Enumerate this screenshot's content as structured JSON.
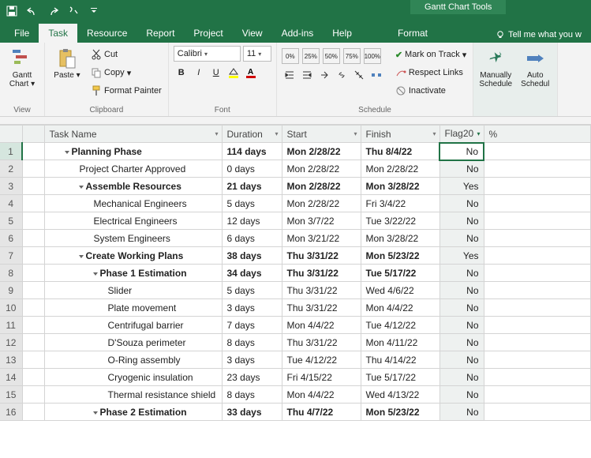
{
  "contextual_tab": "Gantt Chart Tools",
  "tabs": {
    "file": "File",
    "task": "Task",
    "resource": "Resource",
    "report": "Report",
    "project": "Project",
    "view": "View",
    "addins": "Add-ins",
    "help": "Help",
    "format": "Format"
  },
  "tellme": "Tell me what you w",
  "ribbon": {
    "view_group": "View",
    "gantt_chart": "Gantt Chart",
    "clipboard_group": "Clipboard",
    "paste": "Paste",
    "cut": "Cut",
    "copy": "Copy",
    "format_painter": "Format Painter",
    "font_group": "Font",
    "font_name": "Calibri",
    "font_size": "11",
    "schedule_group": "Schedule",
    "mark_on_track": "Mark on Track",
    "respect_links": "Respect Links",
    "inactivate": "Inactivate",
    "manually_schedule": "Manually Schedule",
    "auto_schedule": "Auto Schedul",
    "pct": {
      "p0": "0%",
      "p25": "25%",
      "p50": "50%",
      "p75": "75%",
      "p100": "100%"
    }
  },
  "columns": {
    "task_name": "Task Name",
    "duration": "Duration",
    "start": "Start",
    "finish": "Finish",
    "flag20": "Flag20",
    "pct": "%"
  },
  "rows": [
    {
      "n": 1,
      "lvl": 0,
      "sum": true,
      "name": "Planning Phase",
      "dur": "114 days",
      "start": "Mon 2/28/22",
      "finish": "Thu 8/4/22",
      "flag": "No"
    },
    {
      "n": 2,
      "lvl": 1,
      "sum": false,
      "name": "Project Charter Approved",
      "dur": "0 days",
      "start": "Mon 2/28/22",
      "finish": "Mon 2/28/22",
      "flag": "No"
    },
    {
      "n": 3,
      "lvl": 1,
      "sum": true,
      "name": "Assemble Resources",
      "dur": "21 days",
      "start": "Mon 2/28/22",
      "finish": "Mon 3/28/22",
      "flag": "Yes"
    },
    {
      "n": 4,
      "lvl": 2,
      "sum": false,
      "name": "Mechanical Engineers",
      "dur": "5 days",
      "start": "Mon 2/28/22",
      "finish": "Fri 3/4/22",
      "flag": "No"
    },
    {
      "n": 5,
      "lvl": 2,
      "sum": false,
      "name": "Electrical Engineers",
      "dur": "12 days",
      "start": "Mon 3/7/22",
      "finish": "Tue 3/22/22",
      "flag": "No"
    },
    {
      "n": 6,
      "lvl": 2,
      "sum": false,
      "name": "System Engineers",
      "dur": "6 days",
      "start": "Mon 3/21/22",
      "finish": "Mon 3/28/22",
      "flag": "No"
    },
    {
      "n": 7,
      "lvl": 1,
      "sum": true,
      "name": "Create Working Plans",
      "dur": "38 days",
      "start": "Thu 3/31/22",
      "finish": "Mon 5/23/22",
      "flag": "Yes"
    },
    {
      "n": 8,
      "lvl": 2,
      "sum": true,
      "name": "Phase 1 Estimation",
      "dur": "34 days",
      "start": "Thu 3/31/22",
      "finish": "Tue 5/17/22",
      "flag": "No"
    },
    {
      "n": 9,
      "lvl": 3,
      "sum": false,
      "name": "Slider",
      "dur": "5 days",
      "start": "Thu 3/31/22",
      "finish": "Wed 4/6/22",
      "flag": "No"
    },
    {
      "n": 10,
      "lvl": 3,
      "sum": false,
      "name": "Plate movement",
      "dur": "3 days",
      "start": "Thu 3/31/22",
      "finish": "Mon 4/4/22",
      "flag": "No"
    },
    {
      "n": 11,
      "lvl": 3,
      "sum": false,
      "name": "Centrifugal barrier",
      "dur": "7 days",
      "start": "Mon 4/4/22",
      "finish": "Tue 4/12/22",
      "flag": "No"
    },
    {
      "n": 12,
      "lvl": 3,
      "sum": false,
      "name": "D'Souza perimeter",
      "dur": "8 days",
      "start": "Thu 3/31/22",
      "finish": "Mon 4/11/22",
      "flag": "No"
    },
    {
      "n": 13,
      "lvl": 3,
      "sum": false,
      "name": "O-Ring assembly",
      "dur": "3 days",
      "start": "Tue 4/12/22",
      "finish": "Thu 4/14/22",
      "flag": "No"
    },
    {
      "n": 14,
      "lvl": 3,
      "sum": false,
      "name": "Cryogenic insulation",
      "dur": "23 days",
      "start": "Fri 4/15/22",
      "finish": "Tue 5/17/22",
      "flag": "No"
    },
    {
      "n": 15,
      "lvl": 3,
      "sum": false,
      "name": "Thermal resistance shield",
      "dur": "8 days",
      "start": "Mon 4/4/22",
      "finish": "Wed 4/13/22",
      "flag": "No"
    },
    {
      "n": 16,
      "lvl": 2,
      "sum": true,
      "name": "Phase 2 Estimation",
      "dur": "33 days",
      "start": "Thu 4/7/22",
      "finish": "Mon 5/23/22",
      "flag": "No"
    }
  ]
}
